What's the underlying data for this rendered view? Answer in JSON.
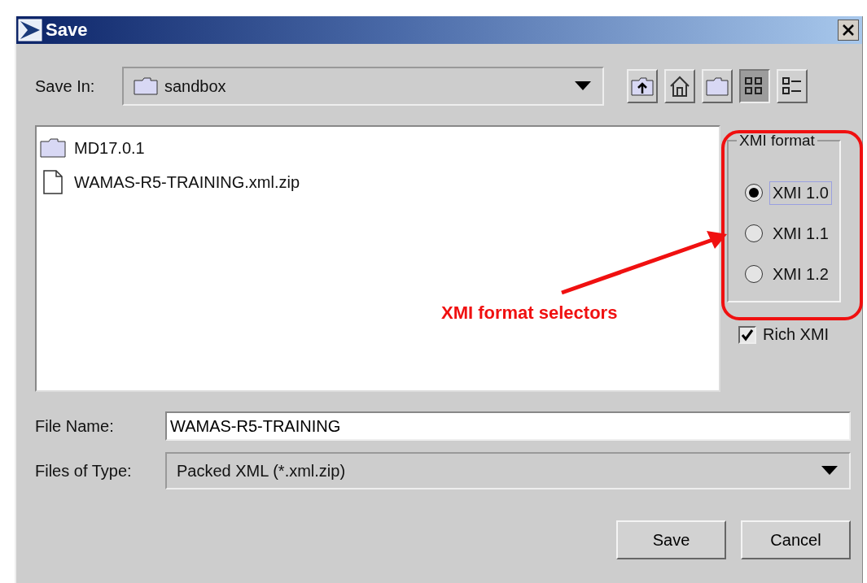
{
  "window": {
    "title": "Save"
  },
  "save_in": {
    "label": "Save In:",
    "value": "sandbox"
  },
  "toolbar": [
    {
      "kind": "up",
      "selected": false
    },
    {
      "kind": "home",
      "selected": false
    },
    {
      "kind": "newfolder",
      "selected": false
    },
    {
      "kind": "list",
      "selected": true
    },
    {
      "kind": "details",
      "selected": false
    }
  ],
  "files": [
    {
      "kind": "folder",
      "name": "MD17.0.1"
    },
    {
      "kind": "file",
      "name": "WAMAS-R5-TRAINING.xml.zip"
    }
  ],
  "xmi_format": {
    "title": "XMI format",
    "options": [
      {
        "label": "XMI 1.0",
        "selected": true
      },
      {
        "label": "XMI 1.1",
        "selected": false
      },
      {
        "label": "XMI 1.2",
        "selected": false
      }
    ]
  },
  "rich_xmi": {
    "label": "Rich XMI",
    "checked": true
  },
  "file_name": {
    "label": "File Name:",
    "value": "WAMAS-R5-TRAINING"
  },
  "files_of_type": {
    "label": "Files of Type:",
    "value": "Packed XML (*.xml.zip)"
  },
  "buttons": [
    "Save",
    "Cancel"
  ],
  "annotation": {
    "text": "XMI format selectors"
  }
}
